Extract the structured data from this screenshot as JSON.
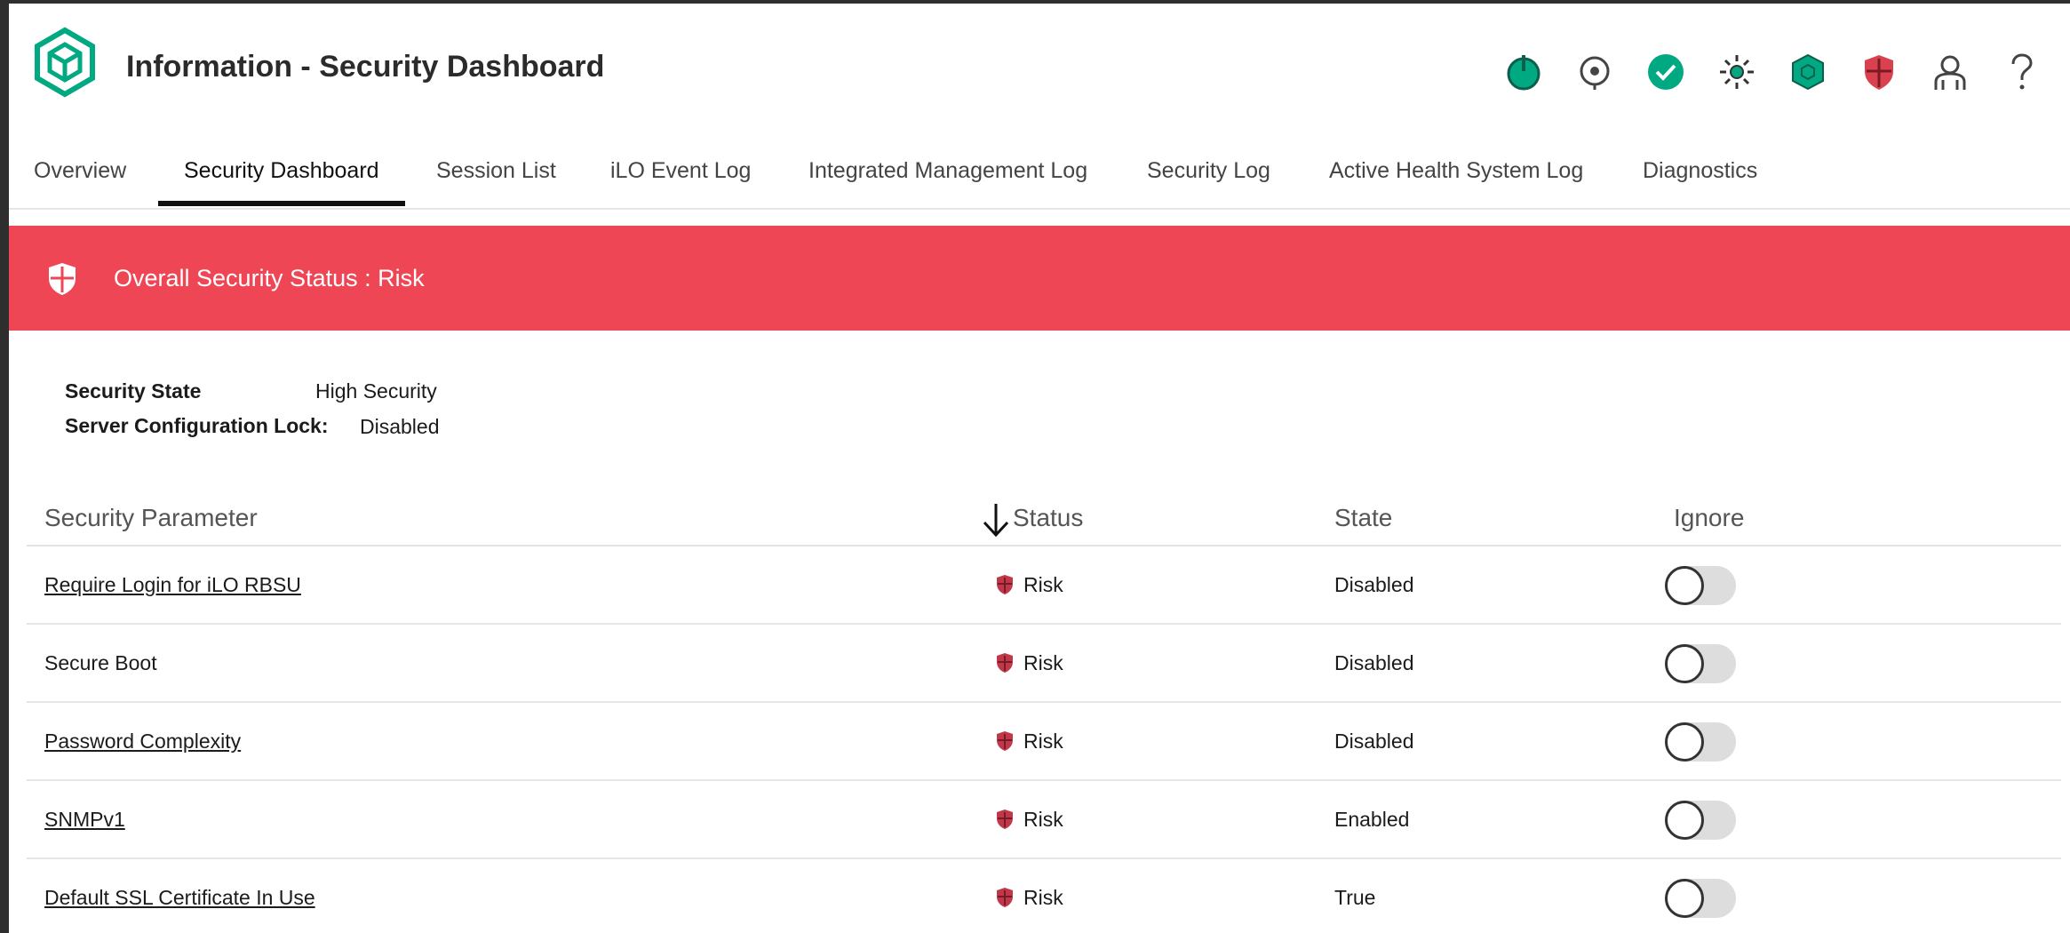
{
  "header": {
    "title": "Information - Security Dashboard",
    "icons": [
      "power-icon",
      "uid-locator-icon",
      "health-ok-icon",
      "brightness-icon",
      "hexagon-icon",
      "security-shield-icon",
      "user-icon",
      "help-icon"
    ]
  },
  "tabs": [
    {
      "label": "Overview"
    },
    {
      "label": "Security Dashboard",
      "active": true
    },
    {
      "label": "Session List"
    },
    {
      "label": "iLO Event Log"
    },
    {
      "label": "Integrated Management Log"
    },
    {
      "label": "Security Log"
    },
    {
      "label": "Active Health System Log"
    },
    {
      "label": "Diagnostics"
    }
  ],
  "banner": {
    "text": "Overall Security Status : Risk",
    "color": "#ef4656"
  },
  "info": {
    "security_state_label": "Security State",
    "security_state_value": "High Security",
    "config_lock_label": "Server Configuration Lock:",
    "config_lock_value": "Disabled"
  },
  "table": {
    "headers": {
      "parameter": "Security Parameter",
      "status": "Status",
      "state": "State",
      "ignore": "Ignore"
    },
    "sort_icon": "sort-down-arrow-icon",
    "rows": [
      {
        "parameter": "Require Login for iLO RBSU",
        "link": true,
        "status": "Risk",
        "state": "Disabled",
        "ignore": false
      },
      {
        "parameter": "Secure Boot",
        "link": false,
        "status": "Risk",
        "state": "Disabled",
        "ignore": false
      },
      {
        "parameter": "Password Complexity",
        "link": true,
        "status": "Risk",
        "state": "Disabled",
        "ignore": false
      },
      {
        "parameter": "SNMPv1",
        "link": true,
        "status": "Risk",
        "state": "Enabled",
        "ignore": false
      },
      {
        "parameter": "Default SSL Certificate In Use",
        "link": true,
        "status": "Risk",
        "state": "True",
        "ignore": false
      }
    ]
  },
  "colors": {
    "accent_green": "#01a982",
    "risk_red": "#c0394a",
    "banner_red": "#ef4656"
  }
}
